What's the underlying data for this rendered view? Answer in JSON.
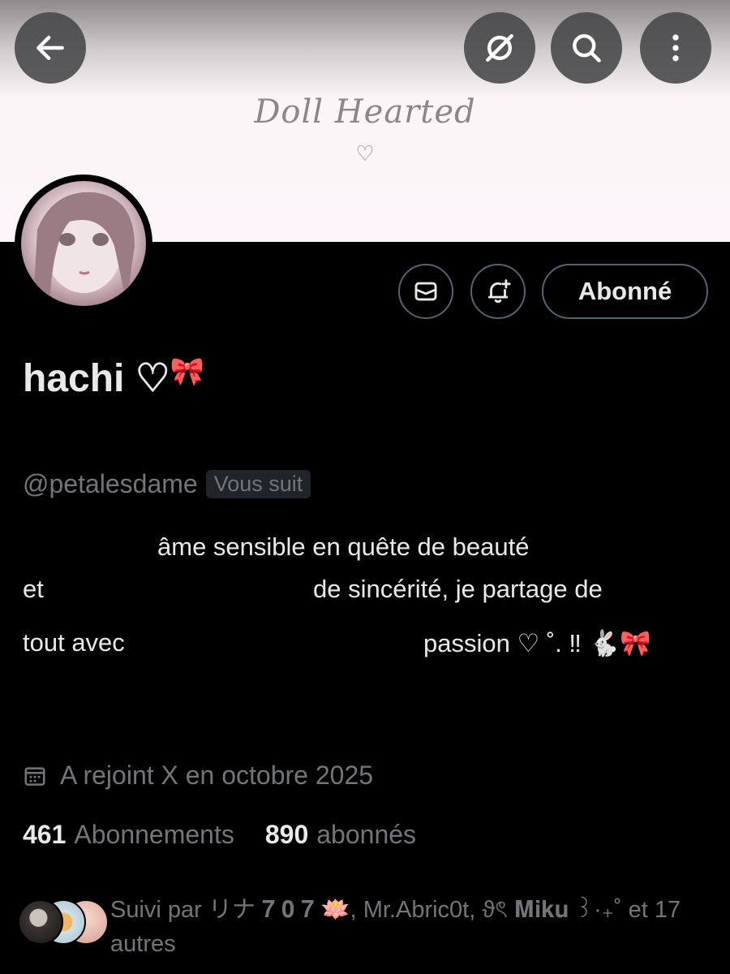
{
  "header": {
    "back_icon": "arrow-left-icon",
    "grok_icon": "grok-icon",
    "search_icon": "search-icon",
    "more_icon": "more-vertical-icon"
  },
  "banner": {
    "title": "Doll Hearted",
    "heart": "♡"
  },
  "actions": {
    "message_icon": "mail-icon",
    "notify_icon": "bell-plus-icon",
    "follow_label": "Abonné"
  },
  "profile": {
    "display_name": "hachi ♡",
    "name_emoji": "🎀",
    "handle": "@petalesdame",
    "follows_you": "Vous suit",
    "bio_lines": [
      "âme sensible en quête de beauté",
      "et",
      "de sincérité, je partage de",
      "tout avec",
      "passion ♡ ˚. ‼ 🐇🎀"
    ],
    "joined": "A rejoint X en octobre 2025"
  },
  "stats": {
    "following_count": "461",
    "following_label": "Abonnements",
    "followers_count": "890",
    "followers_label": "abonnés"
  },
  "followed_by": "Suivi par リナ 𝟕 𝟎 𝟕 🪷, Mr.Abric0t, ϑৎ 𝐌𝐢𝐤𝐮 ꒱·₊˚ et 17 autres",
  "colors": {
    "background": "#000000",
    "text_primary": "#e7e9ea",
    "text_secondary": "#71767b",
    "border": "#536471"
  }
}
